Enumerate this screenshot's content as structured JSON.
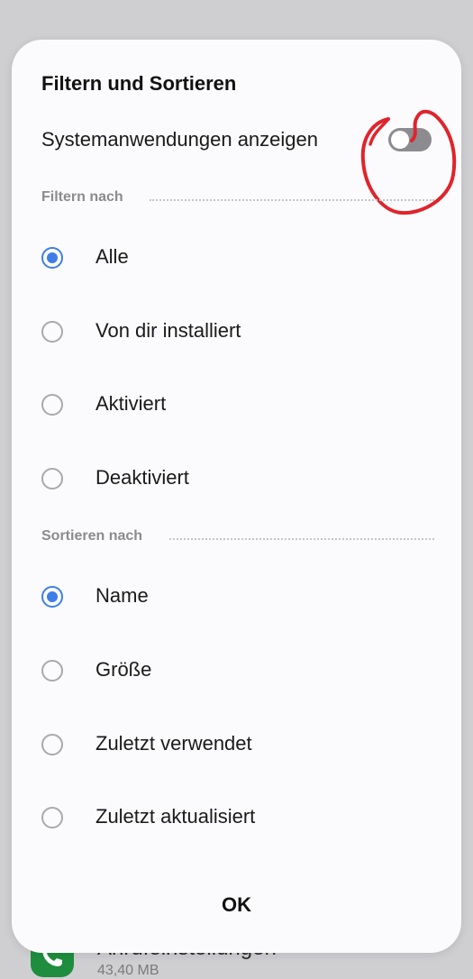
{
  "background": {
    "app_name": "Anrufeinstellungen",
    "app_size": "43,40 MB",
    "app_icon": "phone-icon"
  },
  "dialog": {
    "title": "Filtern und Sortieren",
    "system_apps_label": "Systemanwendungen anzeigen",
    "system_apps_enabled": false,
    "filter_header": "Filtern nach",
    "filter_options": [
      {
        "label": "Alle",
        "selected": true
      },
      {
        "label": "Von dir installiert",
        "selected": false
      },
      {
        "label": "Aktiviert",
        "selected": false
      },
      {
        "label": "Deaktiviert",
        "selected": false
      }
    ],
    "sort_header": "Sortieren nach",
    "sort_options": [
      {
        "label": "Name",
        "selected": true
      },
      {
        "label": "Größe",
        "selected": false
      },
      {
        "label": "Zuletzt verwendet",
        "selected": false
      },
      {
        "label": "Zuletzt aktualisiert",
        "selected": false
      }
    ],
    "ok_label": "OK"
  },
  "colors": {
    "accent": "#3e7ee6",
    "annotation": "#e0242c",
    "toggle_off": "#8c8c90"
  }
}
